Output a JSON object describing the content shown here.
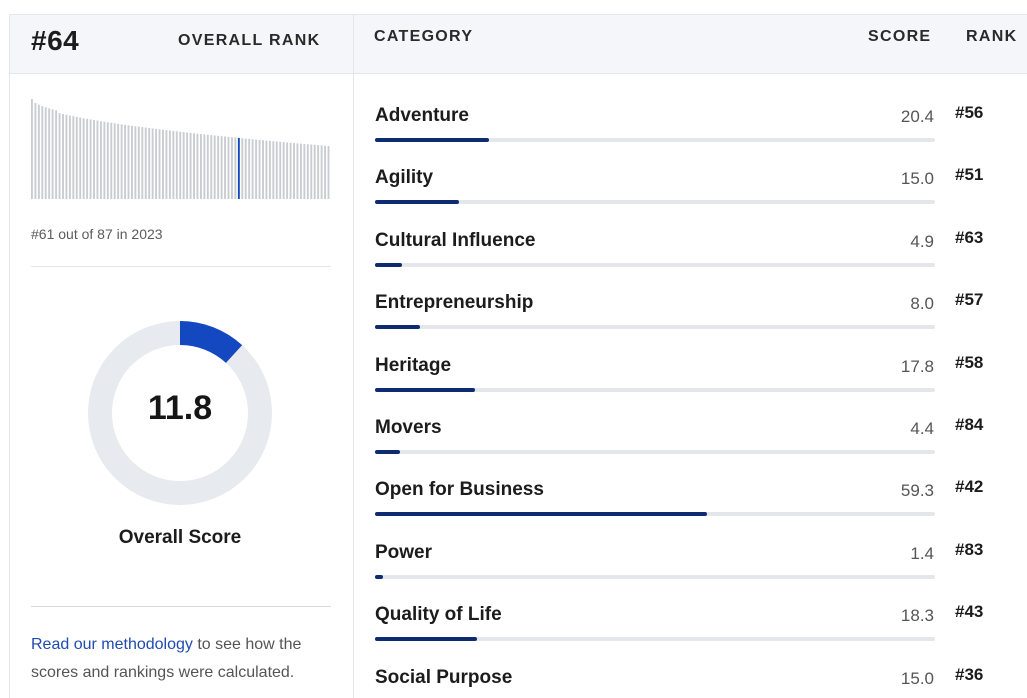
{
  "summary": {
    "rank": "#64",
    "rank_label": "OVERALL RANK",
    "history_text": "#61 out of 87 in 2023",
    "history_bars": 87,
    "history_highlight_index": 60,
    "overall_score": "11.8",
    "overall_score_fraction": 0.118,
    "overall_score_label": "Overall Score",
    "methodology_link": "Read our methodology",
    "methodology_text": " to see how the scores and rankings were calculated."
  },
  "columns": {
    "category": "CATEGORY",
    "score": "SCORE",
    "rank": "RANK"
  },
  "categories": [
    {
      "name": "Adventure",
      "score": "20.4",
      "rank": "#56",
      "value": 20.4
    },
    {
      "name": "Agility",
      "score": "15.0",
      "rank": "#51",
      "value": 15.0
    },
    {
      "name": "Cultural Influence",
      "score": "4.9",
      "rank": "#63",
      "value": 4.9
    },
    {
      "name": "Entrepreneurship",
      "score": "8.0",
      "rank": "#57",
      "value": 8.0
    },
    {
      "name": "Heritage",
      "score": "17.8",
      "rank": "#58",
      "value": 17.8
    },
    {
      "name": "Movers",
      "score": "4.4",
      "rank": "#84",
      "value": 4.4
    },
    {
      "name": "Open for Business",
      "score": "59.3",
      "rank": "#42",
      "value": 59.3
    },
    {
      "name": "Power",
      "score": "1.4",
      "rank": "#83",
      "value": 1.4
    },
    {
      "name": "Quality of Life",
      "score": "18.3",
      "rank": "#43",
      "value": 18.3
    },
    {
      "name": "Social Purpose",
      "score": "15.0",
      "rank": "#36",
      "value": 15.0
    }
  ],
  "score_max": 100,
  "colors": {
    "accent": "#0d2b6e",
    "donut_fill": "#1448c0",
    "donut_track": "#e7eaee",
    "link": "#1f4ab0",
    "history_bar": "#c9ccd1",
    "history_highlight": "#1448c0"
  }
}
